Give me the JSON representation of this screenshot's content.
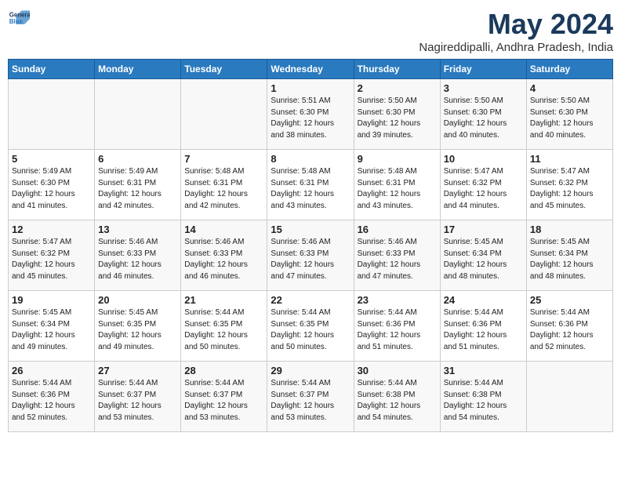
{
  "header": {
    "logo_line1": "General",
    "logo_line2": "Blue",
    "month_title": "May 2024",
    "location": "Nagireddipalli, Andhra Pradesh, India"
  },
  "days_of_week": [
    "Sunday",
    "Monday",
    "Tuesday",
    "Wednesday",
    "Thursday",
    "Friday",
    "Saturday"
  ],
  "weeks": [
    [
      {
        "day": "",
        "content": ""
      },
      {
        "day": "",
        "content": ""
      },
      {
        "day": "",
        "content": ""
      },
      {
        "day": "1",
        "content": "Sunrise: 5:51 AM\nSunset: 6:30 PM\nDaylight: 12 hours\nand 38 minutes."
      },
      {
        "day": "2",
        "content": "Sunrise: 5:50 AM\nSunset: 6:30 PM\nDaylight: 12 hours\nand 39 minutes."
      },
      {
        "day": "3",
        "content": "Sunrise: 5:50 AM\nSunset: 6:30 PM\nDaylight: 12 hours\nand 40 minutes."
      },
      {
        "day": "4",
        "content": "Sunrise: 5:50 AM\nSunset: 6:30 PM\nDaylight: 12 hours\nand 40 minutes."
      }
    ],
    [
      {
        "day": "5",
        "content": "Sunrise: 5:49 AM\nSunset: 6:30 PM\nDaylight: 12 hours\nand 41 minutes."
      },
      {
        "day": "6",
        "content": "Sunrise: 5:49 AM\nSunset: 6:31 PM\nDaylight: 12 hours\nand 42 minutes."
      },
      {
        "day": "7",
        "content": "Sunrise: 5:48 AM\nSunset: 6:31 PM\nDaylight: 12 hours\nand 42 minutes."
      },
      {
        "day": "8",
        "content": "Sunrise: 5:48 AM\nSunset: 6:31 PM\nDaylight: 12 hours\nand 43 minutes."
      },
      {
        "day": "9",
        "content": "Sunrise: 5:48 AM\nSunset: 6:31 PM\nDaylight: 12 hours\nand 43 minutes."
      },
      {
        "day": "10",
        "content": "Sunrise: 5:47 AM\nSunset: 6:32 PM\nDaylight: 12 hours\nand 44 minutes."
      },
      {
        "day": "11",
        "content": "Sunrise: 5:47 AM\nSunset: 6:32 PM\nDaylight: 12 hours\nand 45 minutes."
      }
    ],
    [
      {
        "day": "12",
        "content": "Sunrise: 5:47 AM\nSunset: 6:32 PM\nDaylight: 12 hours\nand 45 minutes."
      },
      {
        "day": "13",
        "content": "Sunrise: 5:46 AM\nSunset: 6:33 PM\nDaylight: 12 hours\nand 46 minutes."
      },
      {
        "day": "14",
        "content": "Sunrise: 5:46 AM\nSunset: 6:33 PM\nDaylight: 12 hours\nand 46 minutes."
      },
      {
        "day": "15",
        "content": "Sunrise: 5:46 AM\nSunset: 6:33 PM\nDaylight: 12 hours\nand 47 minutes."
      },
      {
        "day": "16",
        "content": "Sunrise: 5:46 AM\nSunset: 6:33 PM\nDaylight: 12 hours\nand 47 minutes."
      },
      {
        "day": "17",
        "content": "Sunrise: 5:45 AM\nSunset: 6:34 PM\nDaylight: 12 hours\nand 48 minutes."
      },
      {
        "day": "18",
        "content": "Sunrise: 5:45 AM\nSunset: 6:34 PM\nDaylight: 12 hours\nand 48 minutes."
      }
    ],
    [
      {
        "day": "19",
        "content": "Sunrise: 5:45 AM\nSunset: 6:34 PM\nDaylight: 12 hours\nand 49 minutes."
      },
      {
        "day": "20",
        "content": "Sunrise: 5:45 AM\nSunset: 6:35 PM\nDaylight: 12 hours\nand 49 minutes."
      },
      {
        "day": "21",
        "content": "Sunrise: 5:44 AM\nSunset: 6:35 PM\nDaylight: 12 hours\nand 50 minutes."
      },
      {
        "day": "22",
        "content": "Sunrise: 5:44 AM\nSunset: 6:35 PM\nDaylight: 12 hours\nand 50 minutes."
      },
      {
        "day": "23",
        "content": "Sunrise: 5:44 AM\nSunset: 6:36 PM\nDaylight: 12 hours\nand 51 minutes."
      },
      {
        "day": "24",
        "content": "Sunrise: 5:44 AM\nSunset: 6:36 PM\nDaylight: 12 hours\nand 51 minutes."
      },
      {
        "day": "25",
        "content": "Sunrise: 5:44 AM\nSunset: 6:36 PM\nDaylight: 12 hours\nand 52 minutes."
      }
    ],
    [
      {
        "day": "26",
        "content": "Sunrise: 5:44 AM\nSunset: 6:36 PM\nDaylight: 12 hours\nand 52 minutes."
      },
      {
        "day": "27",
        "content": "Sunrise: 5:44 AM\nSunset: 6:37 PM\nDaylight: 12 hours\nand 53 minutes."
      },
      {
        "day": "28",
        "content": "Sunrise: 5:44 AM\nSunset: 6:37 PM\nDaylight: 12 hours\nand 53 minutes."
      },
      {
        "day": "29",
        "content": "Sunrise: 5:44 AM\nSunset: 6:37 PM\nDaylight: 12 hours\nand 53 minutes."
      },
      {
        "day": "30",
        "content": "Sunrise: 5:44 AM\nSunset: 6:38 PM\nDaylight: 12 hours\nand 54 minutes."
      },
      {
        "day": "31",
        "content": "Sunrise: 5:44 AM\nSunset: 6:38 PM\nDaylight: 12 hours\nand 54 minutes."
      },
      {
        "day": "",
        "content": ""
      }
    ]
  ]
}
